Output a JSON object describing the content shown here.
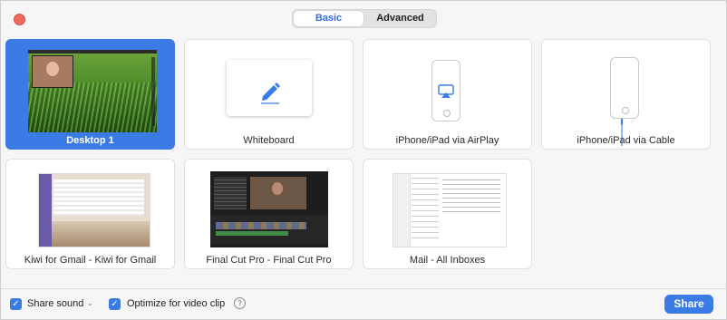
{
  "tabs": {
    "basic": "Basic",
    "advanced": "Advanced",
    "selected": "Basic"
  },
  "tiles": [
    {
      "label": "Desktop 1",
      "selected": true
    },
    {
      "label": "Whiteboard",
      "selected": false
    },
    {
      "label": "iPhone/iPad via AirPlay",
      "selected": false
    },
    {
      "label": "iPhone/iPad via Cable",
      "selected": false
    },
    {
      "label": "Kiwi for Gmail - Kiwi for Gmail",
      "selected": false
    },
    {
      "label": "Final Cut Pro - Final Cut Pro",
      "selected": false
    },
    {
      "label": "Mail - All Inboxes",
      "selected": false
    }
  ],
  "bottom": {
    "share_sound": {
      "label": "Share sound",
      "checked": true
    },
    "optimize": {
      "label": "Optimize for video clip",
      "checked": true
    },
    "help_glyph": "?",
    "share_button": "Share"
  },
  "colors": {
    "accent": "#3b7be5",
    "close": "#ec6a5e"
  },
  "icons": [
    "close-dot",
    "pencil-icon",
    "airplay-icon",
    "lightning-cable-icon",
    "checkbox-icon",
    "chevron-down-icon",
    "help-icon"
  ]
}
